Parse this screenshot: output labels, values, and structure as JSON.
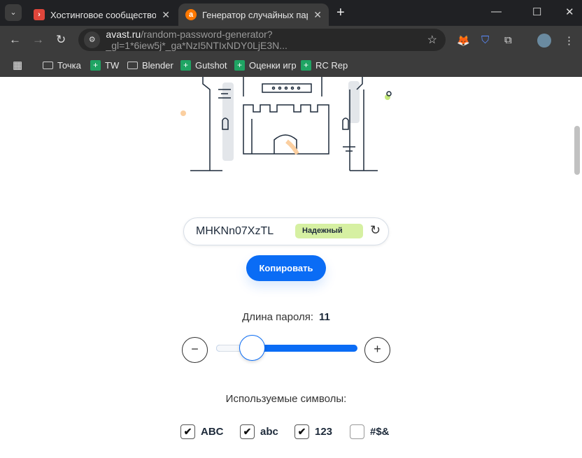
{
  "browser": {
    "tabs": [
      {
        "title": "Хостинговое сообщество «Tim",
        "favicon": "timeweb-icon",
        "active": false
      },
      {
        "title": "Генератор случайных паролей",
        "favicon": "avast-icon",
        "active": true
      }
    ],
    "url_domain": "avast.ru",
    "url_path": "/random-password-generator?_gl=1*6iew5j*_ga*NzI5NTIxNDY0LjE3N...",
    "bookmarks": [
      {
        "label": "Точка",
        "icon": "folder-icon"
      },
      {
        "label": "TW",
        "icon": "sheets-icon"
      },
      {
        "label": "Blender",
        "icon": "folder-icon"
      },
      {
        "label": "Gutshot",
        "icon": "sheets-icon"
      },
      {
        "label": "Оценки игр",
        "icon": "sheets-icon"
      },
      {
        "label": "RC Rep",
        "icon": "sheets-icon"
      }
    ]
  },
  "generator": {
    "password": "MHKNn07XzTL",
    "strength": "Надежный",
    "strength_color": "#d6f0a2",
    "copy_label": "Копировать",
    "length_label": "Длина пароля:",
    "length_value": "11",
    "length_min": 8,
    "length_max": 32,
    "symbols_label": "Используемые символы:",
    "options": [
      {
        "label": "ABC",
        "checked": true
      },
      {
        "label": "abc",
        "checked": true
      },
      {
        "label": "123",
        "checked": true
      },
      {
        "label": "#$&",
        "checked": false
      }
    ],
    "accent": "#0a6cf5"
  }
}
